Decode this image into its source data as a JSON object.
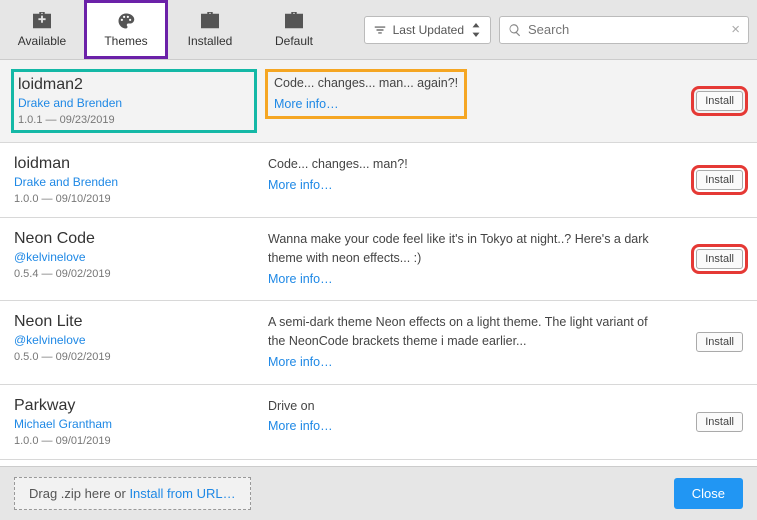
{
  "tabs": [
    {
      "label": "Available"
    },
    {
      "label": "Themes"
    },
    {
      "label": "Installed"
    },
    {
      "label": "Default"
    }
  ],
  "sort_label": "Last Updated",
  "search_placeholder": "Search",
  "themes": [
    {
      "name": "loidman2",
      "author": "Drake and Brenden",
      "version": "1.0.1 — 09/23/2019",
      "desc": "Code... changes... man... again?!",
      "more": "More info…",
      "install": "Install",
      "hl_meta": "hl-box-green",
      "hl_desc": "hl-box-orange",
      "hl_install": "hl-box-red"
    },
    {
      "name": "loidman",
      "author": "Drake and Brenden",
      "version": "1.0.0 — 09/10/2019",
      "desc": "Code... changes... man?!",
      "more": "More info…",
      "install": "Install",
      "hl_meta": "",
      "hl_desc": "",
      "hl_install": "hl-box-red"
    },
    {
      "name": "Neon Code",
      "author": "@kelvinelove",
      "version": "0.5.4 — 09/02/2019",
      "desc": "Wanna make your code feel like it's in Tokyo at night..? Here's a dark theme with neon effects... :)",
      "more": "More info…",
      "install": "Install",
      "hl_meta": "",
      "hl_desc": "",
      "hl_install": "hl-box-red"
    },
    {
      "name": "Neon Lite",
      "author": "@kelvinelove",
      "version": "0.5.0 — 09/02/2019",
      "desc": "A semi-dark theme Neon effects on a light theme. The light variant of the NeonCode brackets theme i made earlier...",
      "more": "More info…",
      "install": "Install",
      "hl_meta": "",
      "hl_desc": "",
      "hl_install": ""
    },
    {
      "name": "Parkway",
      "author": "Michael Grantham",
      "version": "1.0.0 — 09/01/2019",
      "desc": "Drive on",
      "more": "More info…",
      "install": "Install",
      "hl_meta": "",
      "hl_desc": "",
      "hl_install": ""
    }
  ],
  "dropzone_prefix": "Drag .zip here or ",
  "dropzone_link": "Install from URL…",
  "close_label": "Close"
}
